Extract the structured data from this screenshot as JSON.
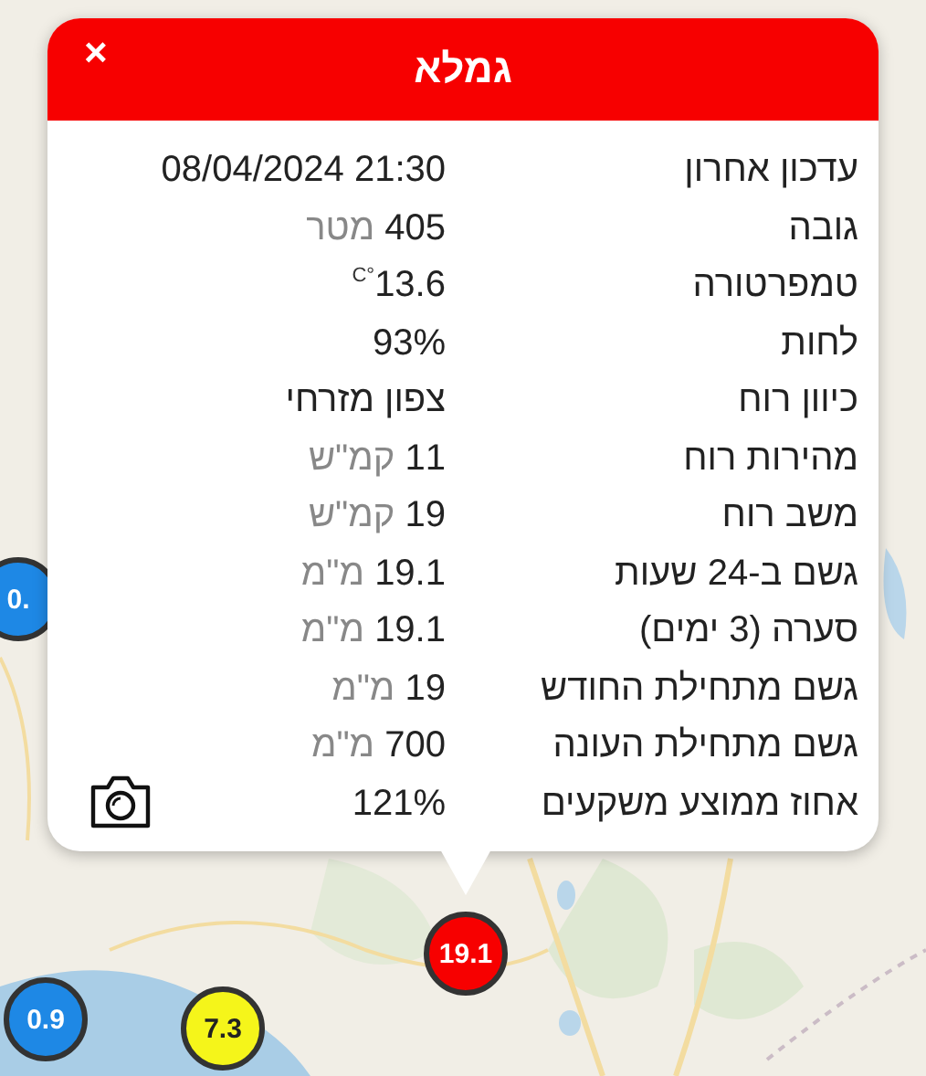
{
  "popup": {
    "title": "גמלא",
    "close": "×",
    "rows": [
      {
        "label": "עדכון אחרון",
        "value": "08/04/2024 21:30",
        "kind": "plain"
      },
      {
        "label": "גובה",
        "value": "405",
        "unit": "מטר",
        "kind": "unit"
      },
      {
        "label": "טמפרטורה",
        "value": "13.6",
        "unit": "°C",
        "kind": "degree"
      },
      {
        "label": "לחות",
        "value": "93%",
        "kind": "plain"
      },
      {
        "label": "כיוון רוח",
        "value": "צפון מזרחי",
        "kind": "plain"
      },
      {
        "label": "מהירות רוח",
        "value": "11",
        "unit": "קמ\"ש",
        "kind": "unit"
      },
      {
        "label": "משב רוח",
        "value": "19",
        "unit": "קמ\"ש",
        "kind": "unit"
      },
      {
        "label": "גשם ב-24 שעות",
        "value": "19.1",
        "unit": "מ\"מ",
        "kind": "unit"
      },
      {
        "label": "סערה (3 ימים)",
        "value": "19.1",
        "unit": "מ\"מ",
        "kind": "unit"
      },
      {
        "label": "גשם מתחילת החודש",
        "value": "19",
        "unit": "מ\"מ",
        "kind": "unit"
      },
      {
        "label": "גשם מתחילת העונה",
        "value": "700",
        "unit": "מ\"מ",
        "kind": "unit"
      },
      {
        "label": "אחוז ממוצע משקעים",
        "value": "121%",
        "kind": "plain"
      }
    ]
  },
  "markers": [
    {
      "value": "0.",
      "color": "#1e88e5"
    },
    {
      "value": "19.1",
      "color": "#f70000"
    },
    {
      "value": "0.9",
      "color": "#1e88e5"
    },
    {
      "value": "7.3",
      "color": "#f5f51a"
    }
  ]
}
